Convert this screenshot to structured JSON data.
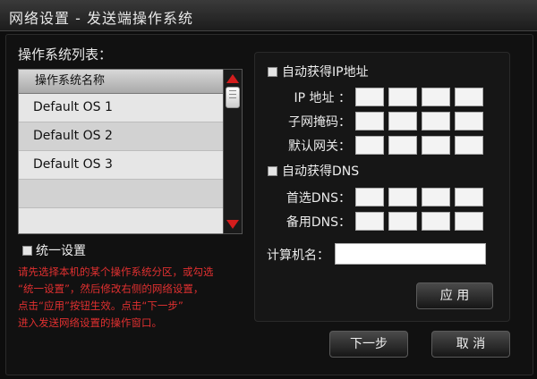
{
  "window": {
    "title": "网络设置 - 发送端操作系统"
  },
  "os_list": {
    "label": "操作系统列表：",
    "header": "操作系统名称",
    "items": [
      "Default OS 1",
      "Default OS 2",
      "Default OS 3"
    ]
  },
  "unified": {
    "label": "统一设置"
  },
  "note_lines": [
    "请先选择本机的某个操作系统分区，或勾选",
    "“统一设置”，然后修改右侧的网络设置，",
    "点击“应用”按钮生效。点击“下一步”",
    "进入发送网络设置的操作窗口。"
  ],
  "network": {
    "auto_ip_label": "自动获得IP地址",
    "ip_label": "IP 地址 ：",
    "mask_label": "子网掩码：",
    "gateway_label": "默认网关：",
    "auto_dns_label": "自动获得DNS",
    "dns1_label": "首选DNS：",
    "dns2_label": "备用DNS：",
    "computer_name_label": "计算机名：",
    "computer_name_value": "",
    "apply_label": "应  用"
  },
  "footer": {
    "next_label": "下一步",
    "cancel_label": "取  消"
  },
  "colors": {
    "note": "#e03030",
    "scroll_arrow": "#d41d1d"
  }
}
